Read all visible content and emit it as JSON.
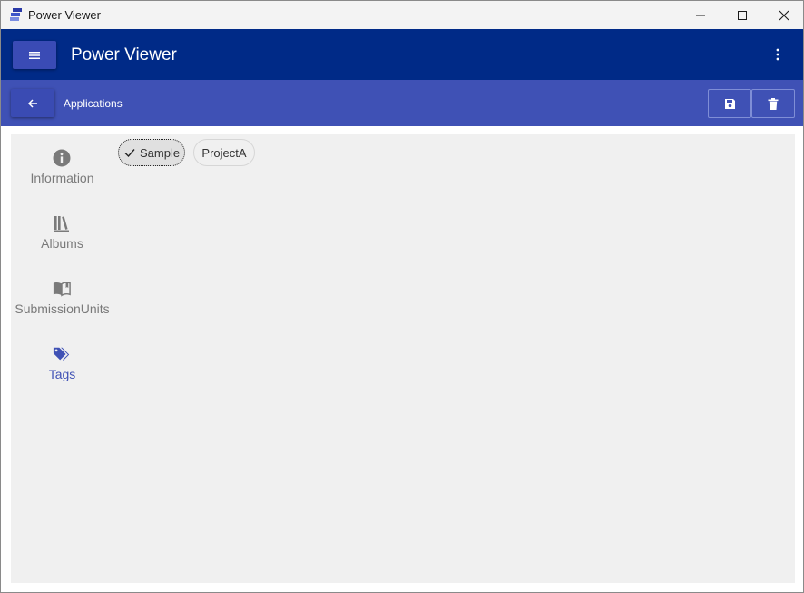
{
  "window": {
    "title": "Power Viewer"
  },
  "appbar": {
    "title": "Power Viewer"
  },
  "subbar": {
    "title": "Applications"
  },
  "nav": {
    "items": [
      {
        "label": "Information",
        "icon": "info-icon",
        "active": false
      },
      {
        "label": "Albums",
        "icon": "library-icon",
        "active": false
      },
      {
        "label": "SubmissionUnits",
        "icon": "book-open-icon",
        "active": false
      },
      {
        "label": "Tags",
        "icon": "tags-icon",
        "active": true
      }
    ]
  },
  "tags": [
    {
      "label": "Sample",
      "selected": true
    },
    {
      "label": "ProjectA",
      "selected": false
    }
  ],
  "colors": {
    "appbar": "#002a87",
    "subbar": "#3f51b5",
    "accent": "#3f51b5",
    "content_bg": "#f0f0f0"
  }
}
